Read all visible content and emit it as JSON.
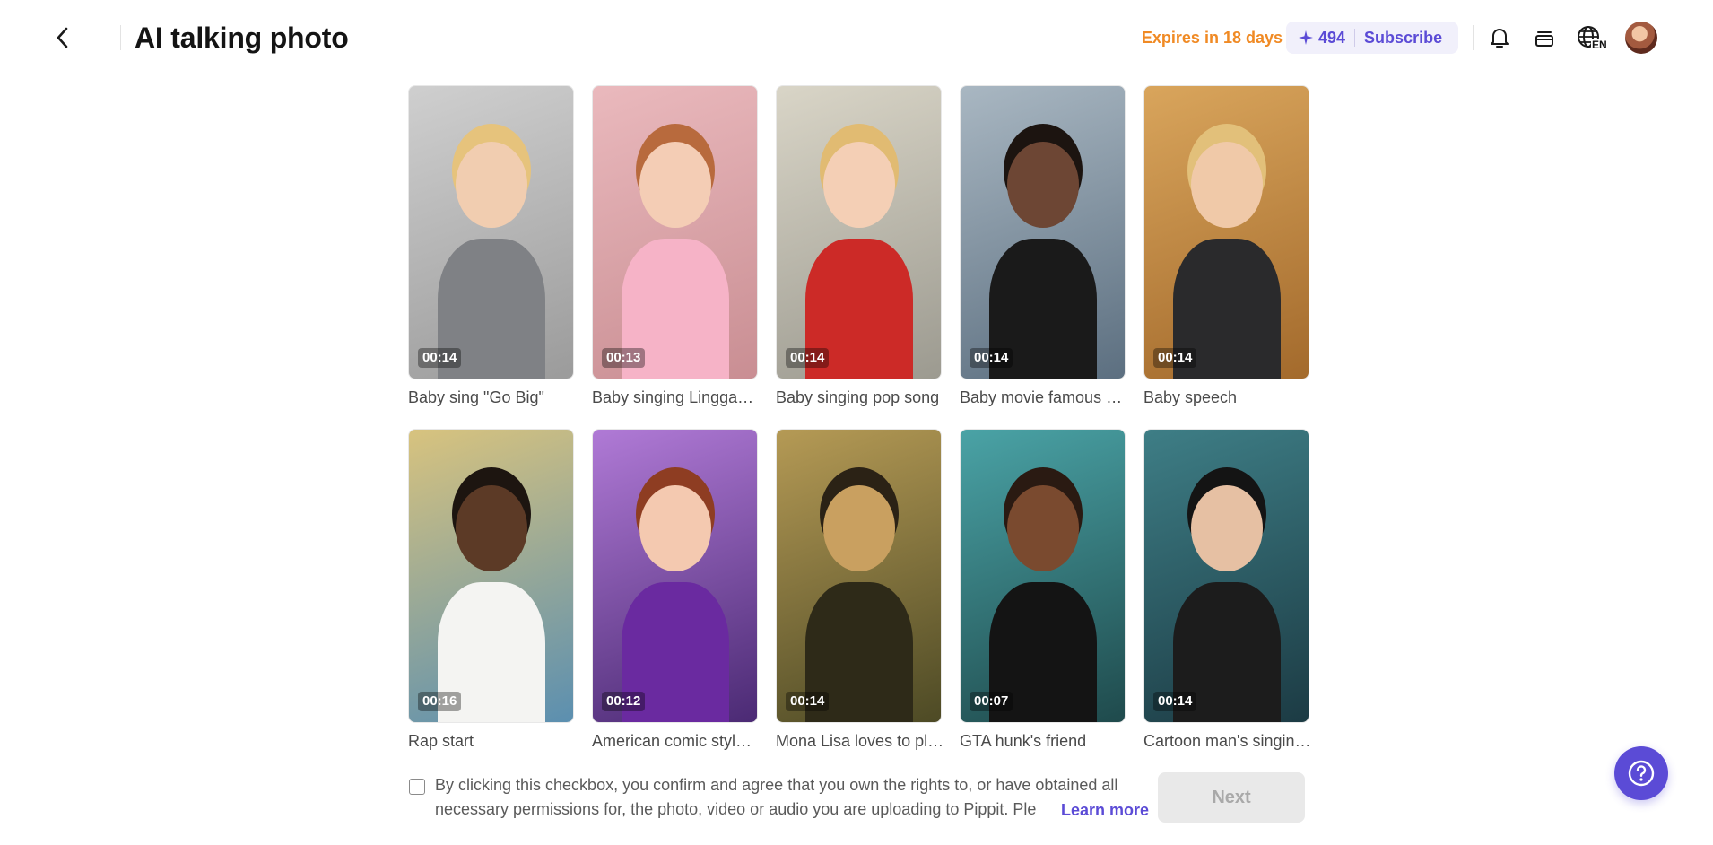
{
  "header": {
    "title": "AI talking photo",
    "expires": "Expires in 18 days",
    "credits": "494",
    "subscribe": "Subscribe",
    "language": "EN"
  },
  "templates": [
    {
      "title": "Baby sing \"Go Big\"",
      "duration": "00:14",
      "bg": [
        "#9b9b9b",
        "#cfcfcf"
      ],
      "skin": "#f1cdb0",
      "hair": "#e6c37c",
      "outfit": "#7f8185"
    },
    {
      "title": "Baby singing Lingga…",
      "duration": "00:13",
      "bg": [
        "#c98e93",
        "#eab9bd"
      ],
      "skin": "#f4cdb5",
      "hair": "#b86a3d",
      "outfit": "#f6b3c7"
    },
    {
      "title": "Baby singing pop song",
      "duration": "00:14",
      "bg": [
        "#9c9a90",
        "#d9d5c7"
      ],
      "skin": "#f4cfb5",
      "hair": "#e1bb72",
      "outfit": "#cc2a27"
    },
    {
      "title": "Baby movie famous s…",
      "duration": "00:14",
      "bg": [
        "#5c6f80",
        "#a9b7c2"
      ],
      "skin": "#6d4634",
      "hair": "#1c1410",
      "outfit": "#1a1a1a"
    },
    {
      "title": "Baby speech",
      "duration": "00:14",
      "bg": [
        "#a36a2c",
        "#d9a55c"
      ],
      "skin": "#f0c9a8",
      "hair": "#e2c07a",
      "outfit": "#2a2a2c"
    },
    {
      "title": "Rap start",
      "duration": "00:16",
      "bg": [
        "#5b8fb0",
        "#d8c37e"
      ],
      "skin": "#5c3a26",
      "hair": "#1d1510",
      "outfit": "#f4f4f2"
    },
    {
      "title": "American comic style…",
      "duration": "00:12",
      "bg": [
        "#4b2a74",
        "#b07ad6"
      ],
      "skin": "#f4c9b0",
      "hair": "#8e3d22",
      "outfit": "#6a2aa0"
    },
    {
      "title": "Mona Lisa loves to pl…",
      "duration": "00:14",
      "bg": [
        "#4d4a25",
        "#b59a55"
      ],
      "skin": "#c9a060",
      "hair": "#2b2215",
      "outfit": "#2e2a18"
    },
    {
      "title": "GTA hunk's friend",
      "duration": "00:07",
      "bg": [
        "#1f4a4c",
        "#4aa3a6"
      ],
      "skin": "#7a4a2f",
      "hair": "#2a1a12",
      "outfit": "#141414"
    },
    {
      "title": "Cartoon man's singin…",
      "duration": "00:14",
      "bg": [
        "#1c3b44",
        "#3e7e86"
      ],
      "skin": "#e6c0a3",
      "hair": "#141414",
      "outfit": "#1c1c1c"
    }
  ],
  "consent": {
    "text": "By clicking this checkbox, you confirm and agree that you own the rights to, or have obtained all necessary permissions for, the photo, video or audio you are uploading to Pippit. Ple",
    "learn_more": "Learn more"
  },
  "next_label": "Next",
  "colors": {
    "accent": "#5b4bd6",
    "expires": "#f08a24",
    "pill_bg": "#f1f0fb"
  }
}
